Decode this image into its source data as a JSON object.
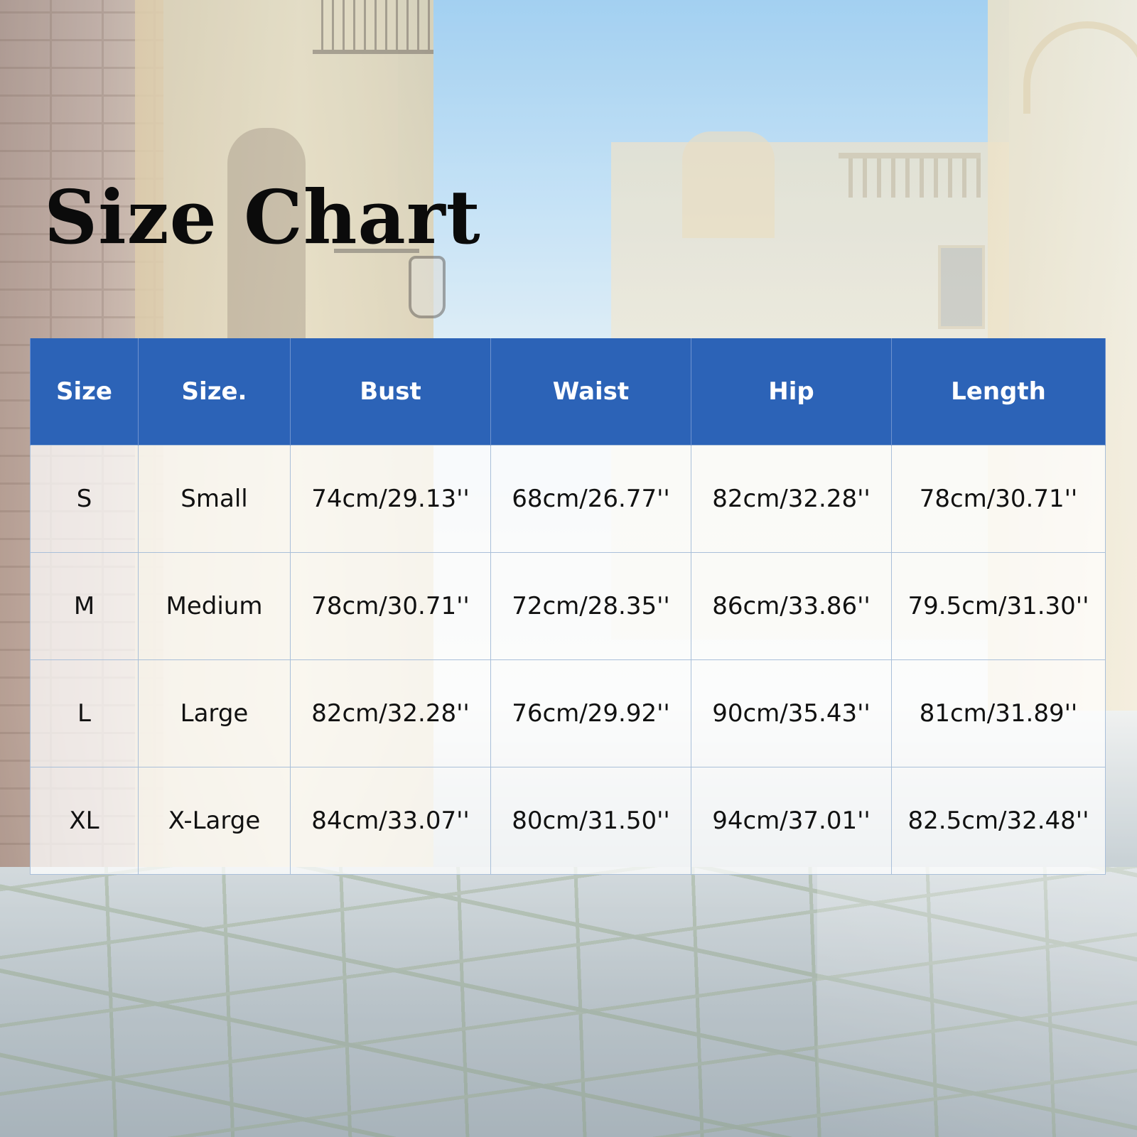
{
  "title": "Size Chart",
  "colors": {
    "header_background": "#2c63b7",
    "header_text": "#ffffff",
    "cell_text": "#111111",
    "title_text": "#0b0b0b"
  },
  "table": {
    "headers": [
      "Size",
      "Size.",
      "Bust",
      "Waist",
      "Hip",
      "Length"
    ],
    "rows": [
      [
        "S",
        "Small",
        "74cm/29.13''",
        "68cm/26.77''",
        "82cm/32.28''",
        "78cm/30.71''"
      ],
      [
        "M",
        "Medium",
        "78cm/30.71''",
        "72cm/28.35''",
        "86cm/33.86''",
        "79.5cm/31.30''"
      ],
      [
        "L",
        "Large",
        "82cm/32.28''",
        "76cm/29.92''",
        "90cm/35.43''",
        "81cm/31.89''"
      ],
      [
        "XL",
        "X-Large",
        "84cm/33.07''",
        "80cm/31.50''",
        "94cm/37.01''",
        "82.5cm/32.48''"
      ]
    ]
  }
}
